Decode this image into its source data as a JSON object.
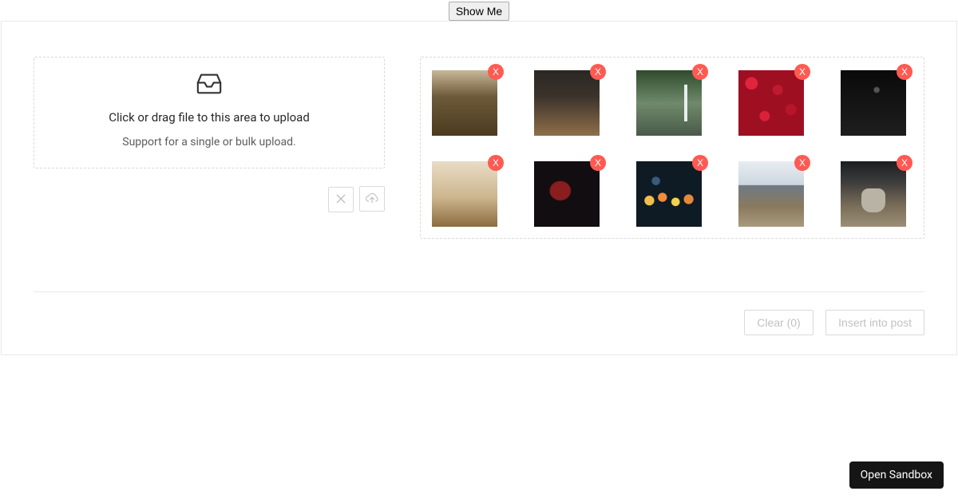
{
  "topbar": {
    "show_me_label": "Show Me"
  },
  "dropzone": {
    "main_text": "Click or drag file to this area to upload",
    "hint_text": "Support for a single or bulk upload."
  },
  "gallery": {
    "remove_glyph": "X",
    "items": [
      {
        "name": "thumb-architecture"
      },
      {
        "name": "thumb-counter"
      },
      {
        "name": "thumb-waterfall"
      },
      {
        "name": "thumb-strawberries"
      },
      {
        "name": "thumb-diver"
      },
      {
        "name": "thumb-boxes"
      },
      {
        "name": "thumb-antler"
      },
      {
        "name": "thumb-bokeh"
      },
      {
        "name": "thumb-skyline"
      },
      {
        "name": "thumb-wolf"
      }
    ]
  },
  "footer": {
    "clear_label": "Clear (0)",
    "insert_label": "Insert into post"
  },
  "sandbox": {
    "open_label": "Open Sandbox"
  }
}
